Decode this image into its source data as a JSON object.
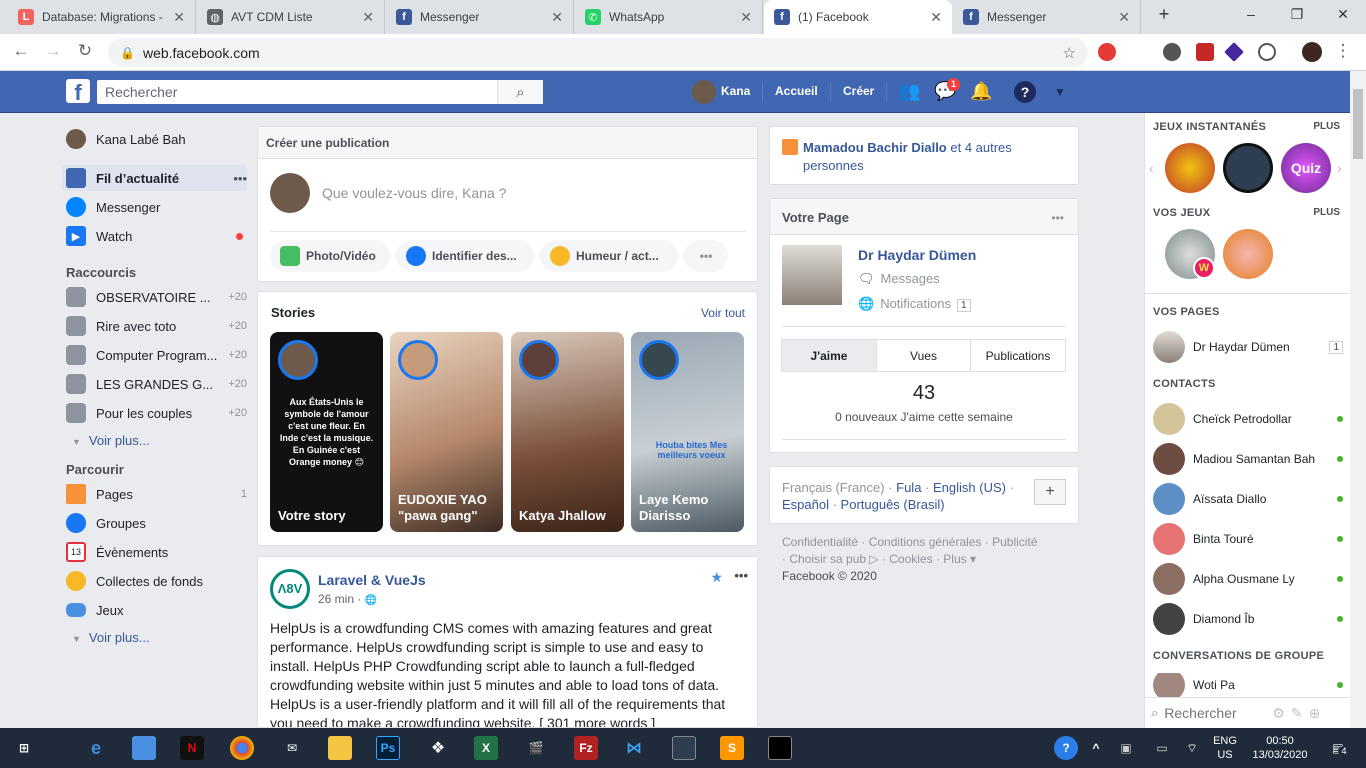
{
  "tabs": [
    {
      "title": "Database: Migrations -",
      "fav_color": "#f4645f",
      "fav_glyph": "L"
    },
    {
      "title": "AVT CDM Liste",
      "fav_color": "#5f6368",
      "fav_glyph": "◍"
    },
    {
      "title": "Messenger",
      "fav_color": "#3b5998",
      "fav_glyph": "f"
    },
    {
      "title": "WhatsApp",
      "fav_color": "#25d366",
      "fav_glyph": "✆"
    },
    {
      "title": "(1) Facebook",
      "fav_color": "#3b5998",
      "fav_glyph": "f"
    },
    {
      "title": "Messenger",
      "fav_color": "#3b5998",
      "fav_glyph": "f"
    }
  ],
  "browser": {
    "url": "web.facebook.com",
    "new_tab": "+",
    "minimize": "–",
    "maximize": "❐",
    "close": "✕"
  },
  "header": {
    "search_placeholder": "Rechercher",
    "user": "Kana",
    "home": "Accueil",
    "create": "Créer",
    "messenger_badge": "1"
  },
  "left": {
    "profile": "Kana Labé Bah",
    "main": [
      {
        "label": "Fil d’actualité",
        "color": "#4267b2"
      },
      {
        "label": "Messenger",
        "color": "#0084ff"
      },
      {
        "label": "Watch",
        "color": "#1877f2"
      }
    ],
    "feed_more": "•••",
    "shortcuts_title": "Raccourcis",
    "shortcuts": [
      {
        "label": "OBSERVATOIRE ...",
        "count": "+20"
      },
      {
        "label": "Rire avec toto",
        "count": "+20"
      },
      {
        "label": "Computer Program...",
        "count": "+20"
      },
      {
        "label": "LES GRANDES G...",
        "count": "+20"
      },
      {
        "label": "Pour les couples",
        "count": "+20"
      }
    ],
    "see_more": "Voir plus...",
    "explore_title": "Parcourir",
    "explore": [
      {
        "label": "Pages",
        "count": "1",
        "color": "#f7923b"
      },
      {
        "label": "Groupes",
        "count": "",
        "color": "#1877f2"
      },
      {
        "label": "Évènements",
        "count": "",
        "color": "#e4303f"
      },
      {
        "label": "Collectes de fonds",
        "count": "",
        "color": "#f7b928"
      },
      {
        "label": "Jeux",
        "count": "",
        "color": "#4a90e2"
      }
    ],
    "see_more2": "Voir plus..."
  },
  "composer": {
    "title": "Créer une publication",
    "placeholder": "Que voulez-vous dire, Kana ?",
    "actions": [
      {
        "label": "Photo/Vidéo",
        "color": "#45bd62"
      },
      {
        "label": "Identifier des...",
        "color": "#1877f2"
      },
      {
        "label": "Humeur / act...",
        "color": "#f7b928"
      }
    ],
    "more": "•••"
  },
  "stories": {
    "title": "Stories",
    "see_all": "Voir tout",
    "items": [
      {
        "name": "Votre story",
        "bg": "#111111",
        "text": "Aux États-Unis le symbole de l'amour c'est une fleur. En Inde c'est la musique. En Guinée c'est Orange money 😊"
      },
      {
        "name": "EUDOXIE YAO \"pawa gang\"",
        "bg": "#c79a7a",
        "text": ""
      },
      {
        "name": "Katya Jhallow",
        "bg": "#7a4e3a",
        "text": ""
      },
      {
        "name": "Laye Kemo Diarisso",
        "bg": "#8a9aa6",
        "text": "Houba bites Mes meilleurs voeux"
      }
    ]
  },
  "post": {
    "author": "Laravel & VueJs",
    "time": "26 min · ",
    "globe": "🌐",
    "body": "HelpUs is a crowdfunding CMS comes with amazing features and great performance. HelpUs crowdfunding script is simple to use and easy to install. HelpUs PHP Crowdfunding script able to launch a full-fledged crowdfunding website within just 5 minutes and able to load tons of data. HelpUs is a user-friendly platform and it will fill all of the requirements that you need to make a crowdfunding website. [ 301 more words ]",
    "star": "★",
    "more": "•••"
  },
  "birthday": {
    "name": "Mamadou Bachir Diallo",
    "rest": " et 4 autres personnes"
  },
  "your_page": {
    "title": "Votre Page",
    "more": "•••",
    "name": "Dr Haydar Dümen",
    "messages": "Messages",
    "notifications": "Notifications",
    "notif_count": "1",
    "tabs": [
      "J'aime",
      "Vues",
      "Publications"
    ],
    "likes": "43",
    "likes_sub": "0 nouveaux J'aime cette semaine"
  },
  "languages": {
    "line1a": "Français (France) · ",
    "line1b": "Fula",
    "line1c": " · ",
    "line1d": "English (US)",
    "line1e": " ·",
    "line2a": "Español",
    "line2b": " · ",
    "line2c": "Português (Brasil)",
    "plus": "+"
  },
  "footer": {
    "line1": "Confidentialité · Conditions générales · Publicité",
    "line2": "· Choisir sa pub ▷ · Cookies · Plus ▾",
    "copyright": "Facebook © 2020"
  },
  "chat": {
    "games_title": "JEUX INSTANTANÉS",
    "games_more": "PLUS",
    "games": [
      {
        "color": "#c0392b"
      },
      {
        "color": "#2c3e50"
      },
      {
        "color": "#9b59b6",
        "label": "Quiz"
      }
    ],
    "your_games_title": "VOS JEUX",
    "your_games_more": "PLUS",
    "your_games": [
      {
        "color": "#7f8c8d"
      },
      {
        "color": "#e67e22"
      }
    ],
    "pages_title": "VOS PAGES",
    "page_name": "Dr Haydar Dümen",
    "page_count": "1",
    "contacts_title": "CONTACTS",
    "contacts": [
      {
        "name": "Cheïck Petrodollar",
        "color": "#d4c49a"
      },
      {
        "name": "Madiou Samantan Bah",
        "color": "#6d4c41"
      },
      {
        "name": "Aïssata Diallo",
        "color": "#5d8fc7"
      },
      {
        "name": "Binta Touré",
        "color": "#e57373"
      },
      {
        "name": "Alpha Ousmane Ly",
        "color": "#8d6e63"
      },
      {
        "name": "Diamond Îb",
        "color": "#424242"
      }
    ],
    "groups_title": "CONVERSATIONS DE GROUPE",
    "group_name": "Woti Pa",
    "search_placeholder": "Rechercher"
  },
  "taskbar": {
    "lang1": "ENG",
    "lang2": "US",
    "time": "00:50",
    "date": "13/03/2020",
    "notif": "4"
  }
}
